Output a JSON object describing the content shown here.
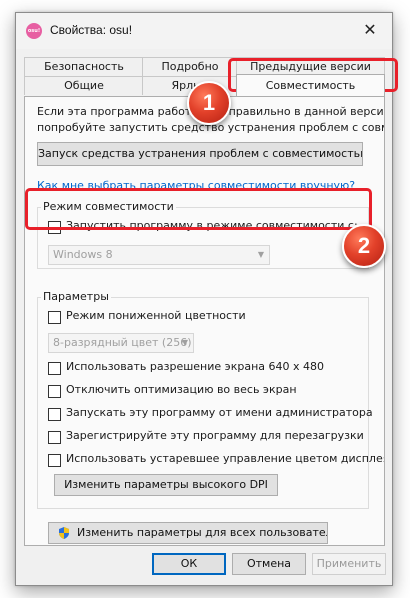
{
  "window": {
    "title": "Свойства: osu!",
    "app_icon_label": "osu!",
    "close_glyph": "✕"
  },
  "tabs": {
    "top": [
      "Безопасность",
      "Подробно",
      "Предыдущие версии"
    ],
    "bottom": [
      "Общие",
      "Ярлык",
      "Совместимость"
    ],
    "active": "Совместимость"
  },
  "intro": {
    "line1": "Если эта программа работает неправильно в данной версии Windows,",
    "line2": "попробуйте запустить средство устранения проблем с совместимостью."
  },
  "troubleshoot_button": "Запуск средства устранения проблем с совместимостью",
  "help_link": "Как мне выбрать параметры совместимости вручную?",
  "compat_mode": {
    "legend": "Режим совместимости",
    "checkbox_label": "Запустить программу в режиме совместимости с:",
    "checked": false,
    "os_value": "Windows 8"
  },
  "settings": {
    "legend": "Параметры",
    "reduced_color_label": "Режим пониженной цветности",
    "color_value": "8-разрядный цвет (256)",
    "options": [
      "Использовать разрешение экрана 640 x 480",
      "Отключить оптимизацию во весь экран",
      "Запускать эту программу от имени администратора",
      "Зарегистрируйте эту программу для перезагрузки",
      "Использовать устаревшее управление цветом дисплея ICC"
    ],
    "dpi_button": "Изменить параметры высокого DPI"
  },
  "all_users_button": "Изменить параметры для всех пользователей",
  "footer": {
    "ok": "ОК",
    "cancel": "Отмена",
    "apply": "Применить"
  },
  "annotations": {
    "badge1": "1",
    "badge2": "2",
    "accent_color": "#e8202a"
  }
}
